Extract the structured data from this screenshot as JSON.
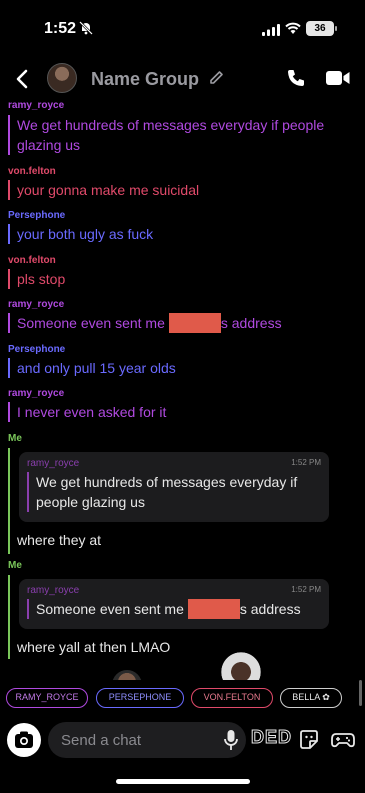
{
  "status_bar": {
    "time": "1:52",
    "battery": "36"
  },
  "header": {
    "group_name": "Name Group"
  },
  "messages": [
    {
      "sender": "ramy_royce",
      "text": "We get hundreds of messages everyday if people glazing us"
    },
    {
      "sender": "von.felton",
      "text": "your gonna make me suicidal"
    },
    {
      "sender": "Persephone",
      "text": "your both ugly as fuck"
    },
    {
      "sender": "von.felton",
      "text": "pls stop"
    },
    {
      "sender": "ramy_royce",
      "text_before": "Someone even sent me",
      "text_after": "s address"
    },
    {
      "sender": "Persephone",
      "text": "and only pull 15 year olds"
    },
    {
      "sender": "ramy_royce",
      "text": "I never even asked for it"
    }
  ],
  "my_replies": [
    {
      "sender": "Me",
      "quote": {
        "sender": "ramy_royce",
        "time": "1:52 PM",
        "text": "We get hundreds of messages everyday if people glazing us"
      },
      "text": "where they at"
    },
    {
      "sender": "Me",
      "quote": {
        "sender": "ramy_royce",
        "time": "1:52 PM",
        "text_before": "Someone even sent me",
        "text_after": "s address"
      },
      "text": "where yall at then LMAO"
    }
  ],
  "presence": [
    {
      "label": "RAMY_ROYCE",
      "color": "#b04ae0"
    },
    {
      "label": "PERSEPHONE",
      "color": "#6a6aff"
    },
    {
      "label": "VON.FELTON",
      "color": "#e04a6a"
    },
    {
      "label": "BELLA",
      "color": "#cfcfcf"
    }
  ],
  "composer": {
    "placeholder": "Send a chat",
    "sticker_text": "DED"
  },
  "icons": {
    "back": "chevron-left-icon",
    "edit": "pencil-icon",
    "call": "phone-icon",
    "video": "video-camera-icon",
    "camera": "camera-icon",
    "mic": "microphone-icon",
    "sticker": "sticker-icon",
    "games": "gamepad-icon"
  }
}
